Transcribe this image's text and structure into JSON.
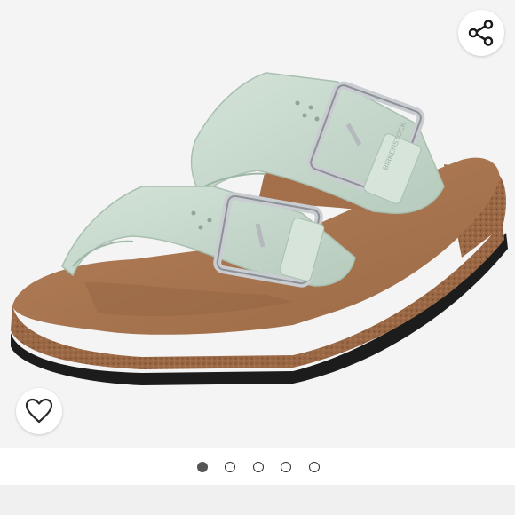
{
  "gallery": {
    "image_alt": "",
    "image_count": 5,
    "active_index": 0,
    "share_icon": "share-icon",
    "wishlist_icon": "heart-outline-icon"
  },
  "colors": {
    "viewer_background": "#f4f4f4",
    "strap": "#c5d8cb",
    "footbed": "#a8734a",
    "cork": "#8c5a38",
    "sole": "#1c1c1c",
    "buckle": "#c9ccd0",
    "dot_active": "#555555"
  }
}
